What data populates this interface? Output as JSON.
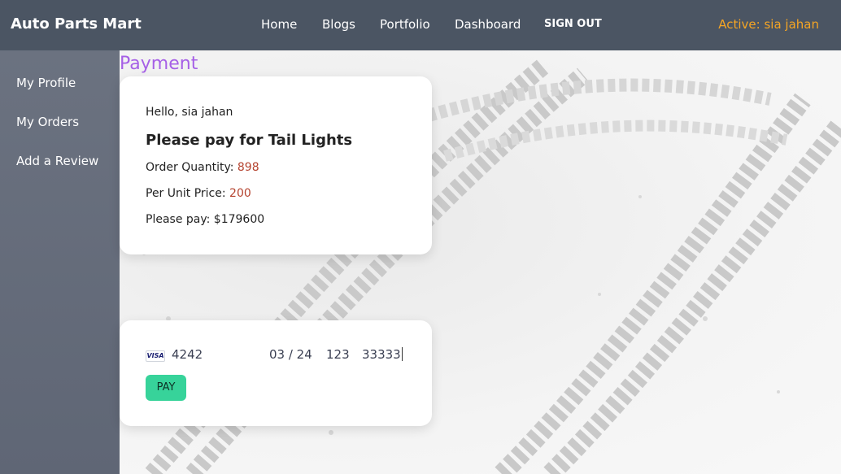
{
  "navbar": {
    "brand": "Auto Parts Mart",
    "links": [
      "Home",
      "Blogs",
      "Portfolio",
      "Dashboard"
    ],
    "signout_label": "SIGN OUT",
    "active_user": "Active: sia jahan"
  },
  "sidebar": {
    "items": [
      {
        "label": "My Profile"
      },
      {
        "label": "My Orders"
      },
      {
        "label": "Add a Review"
      }
    ]
  },
  "main": {
    "title": "Payment",
    "order": {
      "greeting": "Hello, sia jahan",
      "product_line": "Please pay for Tail Lights",
      "quantity_label": "Order Quantity: ",
      "quantity_value": "898",
      "price_label": "Per Unit Price: ",
      "price_value": "200",
      "total_label": "Please pay: $179600"
    },
    "payment": {
      "card_brand": "VISA",
      "card_number": "4242",
      "expiry": "03 / 24",
      "cvc": "123",
      "zip": "33333",
      "pay_label": "PAY"
    }
  },
  "colors": {
    "navbar_bg": "#4b5563",
    "sidebar_bg": "#6b7280",
    "title_purple": "#a660e6",
    "active_orange": "#f5a524",
    "value_red": "#b5432f",
    "pay_green": "#37d39a"
  }
}
